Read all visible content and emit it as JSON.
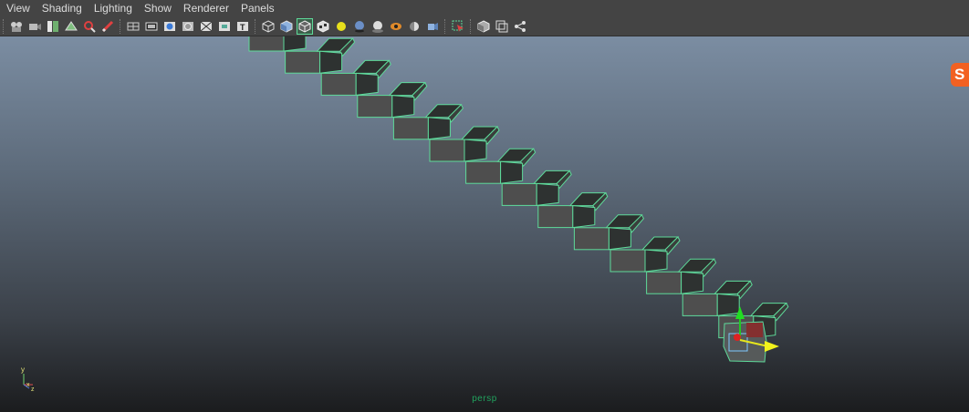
{
  "menu": {
    "items": [
      "View",
      "Shading",
      "Lighting",
      "Show",
      "Renderer",
      "Panels"
    ]
  },
  "toolbar": {
    "groups": [
      [
        "select-camera-icon",
        "camera-attributes-icon",
        "bookmarks-icon",
        "image-plane-icon",
        "2d-pan-zoom-icon",
        "grease-pencil-icon"
      ],
      [
        "grid-icon",
        "film-gate-icon",
        "resolution-gate-icon",
        "gate-mask-icon",
        "field-chart-icon",
        "safe-action-icon",
        "safe-title-icon"
      ],
      [
        "wireframe-icon",
        "smooth-shade-icon",
        "wireframe-on-shaded-icon",
        "textured-icon",
        "use-all-lights-icon",
        "shadows-icon",
        "screen-space-ao-icon",
        "motion-blur-icon",
        "multisample-aa-icon",
        "depth-of-field-icon"
      ],
      [
        "isolate-select-icon"
      ],
      [
        "xray-icon",
        "xray-joints-icon",
        "xray-active-components-icon"
      ]
    ],
    "active": "wireframe-on-shaded-icon"
  },
  "viewport": {
    "camera_label": "persp",
    "axis": {
      "x": "x",
      "y": "y",
      "z": "z"
    }
  },
  "ime_badge": "S",
  "colors": {
    "menubar_bg": "#444444",
    "menu_text": "#dddddd",
    "viewport_top": "#7b8da2",
    "viewport_bottom": "#1b1c1e",
    "selection_wire": "#5eda9a",
    "camera_label": "#21a35e",
    "step_face": "#4e4e4e",
    "step_top": "#2c302e"
  }
}
